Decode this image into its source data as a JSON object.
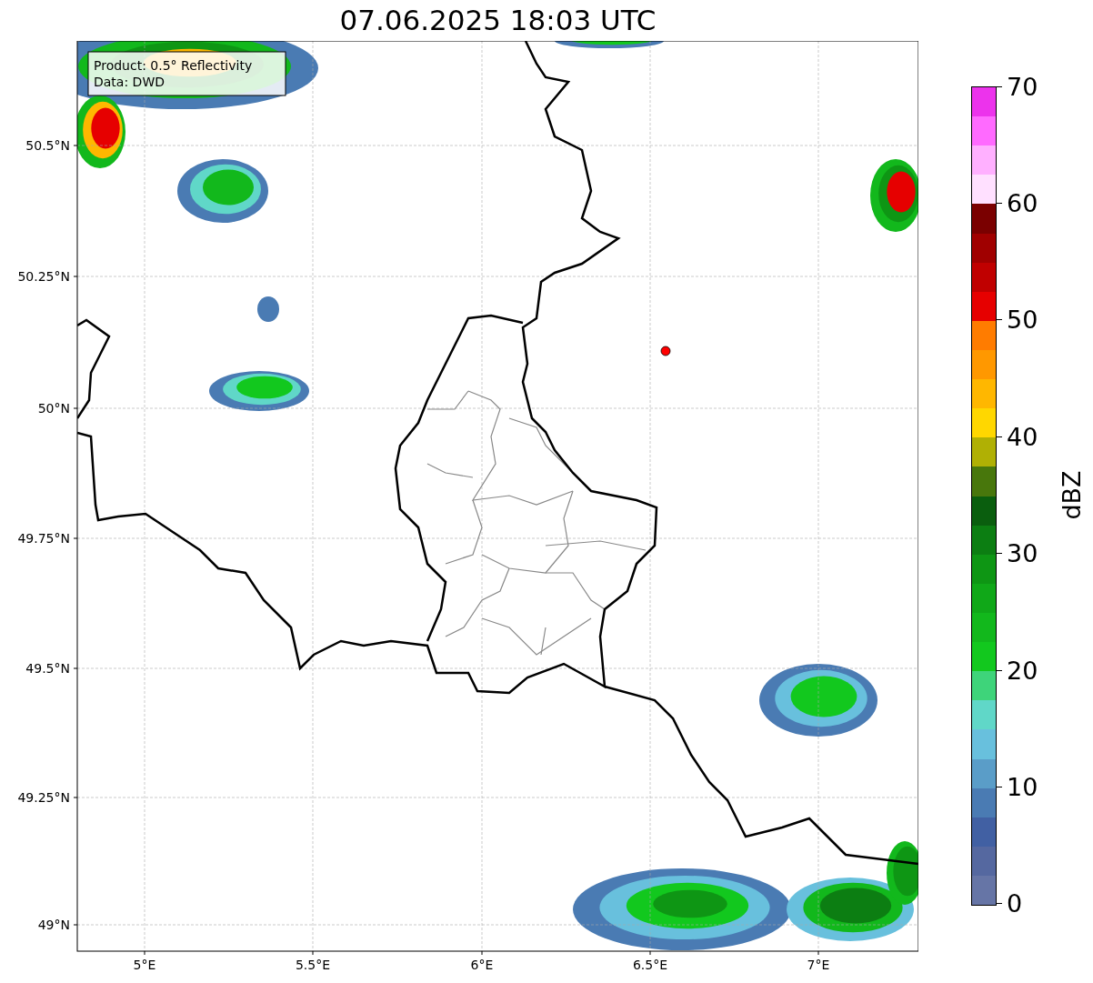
{
  "title": "07.06.2025 18:03 UTC",
  "info_box": {
    "lines": [
      "Product: 0.5° Reflectivity",
      "Data: DWD"
    ]
  },
  "y_ticks": [
    "50.5°N",
    "50.25°N",
    "50°N",
    "49.75°N",
    "49.5°N",
    "49.25°N",
    "49°N"
  ],
  "x_ticks": [
    "5°E",
    "5.5°E",
    "6°E",
    "6.5°E",
    "7°E"
  ],
  "colorbar": {
    "label": "dBZ",
    "ticks": [
      "70",
      "60",
      "50",
      "40",
      "30",
      "20",
      "10",
      "0"
    ],
    "segments": [
      {
        "color": "#ec33ec"
      },
      {
        "color": "#ff6aff"
      },
      {
        "color": "#ffb0ff"
      },
      {
        "color": "#ffe0ff"
      },
      {
        "color": "#7a0000"
      },
      {
        "color": "#a00000"
      },
      {
        "color": "#c00000"
      },
      {
        "color": "#e60000"
      },
      {
        "color": "#ff7c00"
      },
      {
        "color": "#ff9800"
      },
      {
        "color": "#ffb700"
      },
      {
        "color": "#ffd700"
      },
      {
        "color": "#b0b004"
      },
      {
        "color": "#48770c"
      },
      {
        "color": "#0a5e0e"
      },
      {
        "color": "#0c7e12"
      },
      {
        "color": "#0e9614"
      },
      {
        "color": "#10a818"
      },
      {
        "color": "#12b81c"
      },
      {
        "color": "#12c81e"
      },
      {
        "color": "#3ed47a"
      },
      {
        "color": "#60d7c8"
      },
      {
        "color": "#68c0dd"
      },
      {
        "color": "#5a9dc8"
      },
      {
        "color": "#4a7bb3"
      },
      {
        "color": "#4160a3"
      },
      {
        "color": "#5568a0"
      },
      {
        "color": "#6675a6"
      }
    ]
  }
}
